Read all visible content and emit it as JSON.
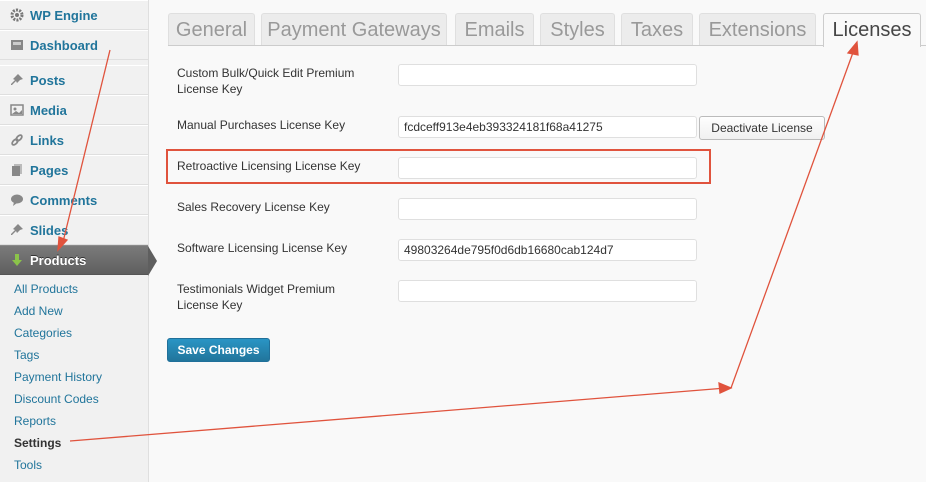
{
  "sidebar": {
    "menu": [
      {
        "label": "WP Engine",
        "icon": "gear-icon"
      },
      {
        "label": "Dashboard",
        "icon": "dashboard-icon"
      },
      {
        "label": "Posts",
        "icon": "pushpin-icon"
      },
      {
        "label": "Media",
        "icon": "media-icon"
      },
      {
        "label": "Links",
        "icon": "link-icon"
      },
      {
        "label": "Pages",
        "icon": "pages-icon"
      },
      {
        "label": "Comments",
        "icon": "comment-icon"
      },
      {
        "label": "Slides",
        "icon": "pushpin-icon"
      },
      {
        "label": "Products",
        "icon": "download-arrow-icon"
      }
    ],
    "submenu": [
      {
        "label": "All Products"
      },
      {
        "label": "Add New"
      },
      {
        "label": "Categories"
      },
      {
        "label": "Tags"
      },
      {
        "label": "Payment History"
      },
      {
        "label": "Discount Codes"
      },
      {
        "label": "Reports"
      },
      {
        "label": "Settings",
        "current": true
      },
      {
        "label": "Tools"
      }
    ]
  },
  "tabs": [
    {
      "label": "General"
    },
    {
      "label": "Payment Gateways"
    },
    {
      "label": "Emails"
    },
    {
      "label": "Styles"
    },
    {
      "label": "Taxes"
    },
    {
      "label": "Extensions"
    },
    {
      "label": "Licenses",
      "active": true
    }
  ],
  "form": {
    "rows": [
      {
        "label": "Custom Bulk/Quick Edit Premium License Key",
        "value": ""
      },
      {
        "label": "Manual Purchases License Key",
        "value": "fcdceff913e4eb393324181f68a41275"
      },
      {
        "label": "Retroactive Licensing License Key",
        "value": ""
      },
      {
        "label": "Sales Recovery License Key",
        "value": ""
      },
      {
        "label": "Software Licensing License Key",
        "value": "49803264de795f0d6db16680cab124d7"
      },
      {
        "label": "Testimonials Widget Premium License Key",
        "value": ""
      }
    ],
    "deactivate_label": "Deactivate License",
    "save_label": "Save Changes"
  },
  "colors": {
    "link": "#21759b",
    "annotation": "#e0533d",
    "primary_button": "#21759b"
  }
}
